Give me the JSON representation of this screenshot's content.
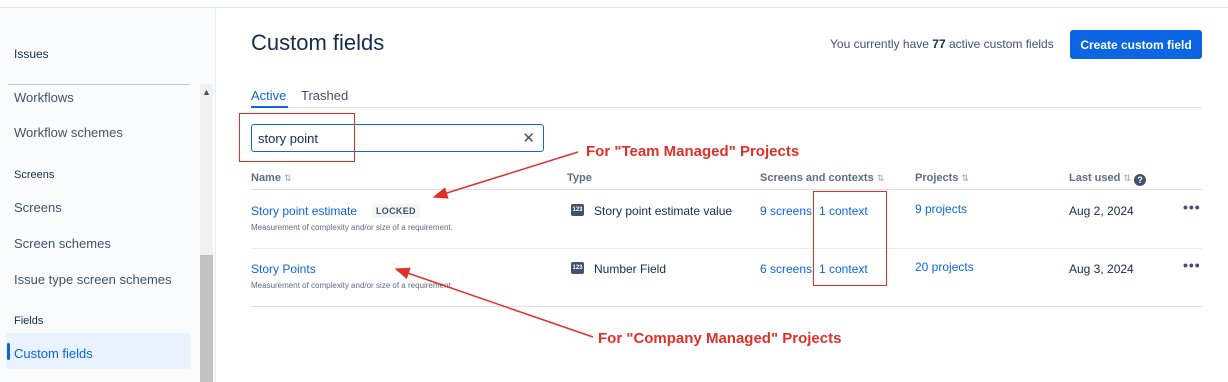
{
  "sidebar": {
    "issues_heading": "Issues",
    "workflows": "Workflows",
    "workflow_schemes": "Workflow schemes",
    "screens_heading": "Screens",
    "screens": "Screens",
    "screen_schemes": "Screen schemes",
    "issue_type_screen_schemes": "Issue type screen schemes",
    "fields_heading": "Fields",
    "custom_fields": "Custom fields"
  },
  "header": {
    "title": "Custom fields",
    "active_prefix": "You currently have",
    "active_count": "77",
    "active_suffix": "active custom fields",
    "create_button": "Create custom field"
  },
  "tabs": {
    "active": "Active",
    "trashed": "Trashed"
  },
  "search": {
    "value": "story point",
    "clear_glyph": "✕"
  },
  "table": {
    "columns": {
      "name": "Name",
      "type": "Type",
      "screens_contexts": "Screens and contexts",
      "projects": "Projects",
      "last_used": "Last used"
    },
    "rows": [
      {
        "name": "Story point estimate",
        "badge": "LOCKED",
        "description": "Measurement of complexity and/or size of a requirement.",
        "type_icon": "123",
        "type": "Story point estimate value",
        "screens": "9 screens",
        "contexts": "1 context",
        "projects": "9 projects",
        "last_used": "Aug 2, 2024"
      },
      {
        "name": "Story Points",
        "description": "Measurement of complexity and/or size of a requirement.",
        "type_icon": "123",
        "type": "Number Field",
        "screens": "6 screens",
        "contexts": "1 context",
        "projects": "20 projects",
        "last_used": "Aug 3, 2024"
      }
    ]
  },
  "annotations": {
    "team": "For \"Team Managed\" Projects",
    "company": "For \"Company Managed\" Projects",
    "color": "#e0302a"
  },
  "colors": {
    "accent": "#0c66e4",
    "text": "#172b4d",
    "annotation": "#e0302a"
  }
}
